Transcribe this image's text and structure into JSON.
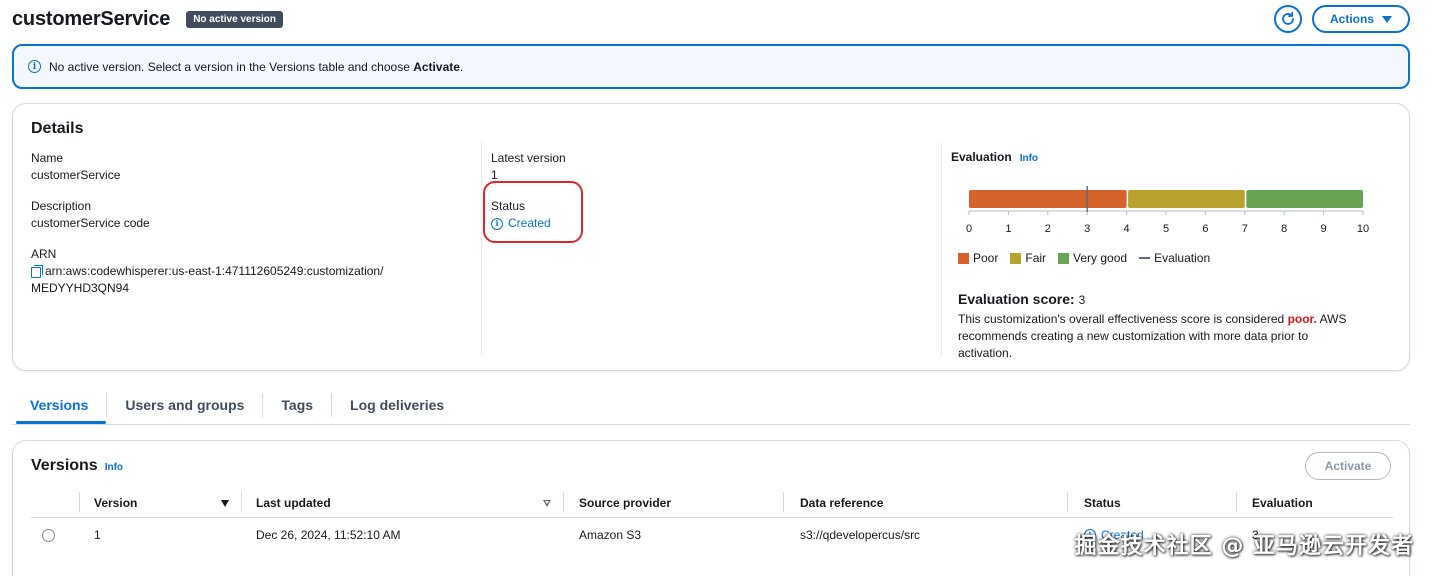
{
  "header": {
    "title": "customerService",
    "badge": "No active version",
    "actions_label": "Actions"
  },
  "alert": {
    "text_prefix": "No active version. Select a version in the Versions table and choose ",
    "text_bold": "Activate",
    "text_suffix": "."
  },
  "details": {
    "title": "Details",
    "name_label": "Name",
    "name_value": "customerService",
    "description_label": "Description",
    "description_value": "customerService code",
    "arn_label": "ARN",
    "arn_line1": "arn:aws:codewhisperer:us-east-1:471112605249:customization/",
    "arn_line2": "MEDYYHD3QN94",
    "latest_version_label": "Latest version",
    "latest_version_value": "1",
    "status_label": "Status",
    "status_value": "Created"
  },
  "evaluation": {
    "title": "Evaluation",
    "info": "Info",
    "scale_ticks": [
      "0",
      "1",
      "2",
      "3",
      "4",
      "5",
      "6",
      "7",
      "8",
      "9",
      "10"
    ],
    "segments": [
      {
        "name": "Poor",
        "from": 0,
        "to": 4,
        "color": "#d4622a"
      },
      {
        "name": "Fair",
        "from": 4,
        "to": 7,
        "color": "#b8a12c"
      },
      {
        "name": "Very good",
        "from": 7,
        "to": 10,
        "color": "#67a353"
      }
    ],
    "score": 3,
    "legend": {
      "poor": "Poor",
      "fair": "Fair",
      "very_good": "Very good",
      "evaluation": "Evaluation"
    },
    "score_label": "Evaluation score:",
    "score_value": "3",
    "desc_prefix": "This customization's overall effectiveness score is considered ",
    "desc_poor": "poor.",
    "desc_suffix": " AWS recommends creating a new customization with more data prior to activation."
  },
  "tabs": [
    {
      "label": "Versions",
      "active": true
    },
    {
      "label": "Users and groups",
      "active": false
    },
    {
      "label": "Tags",
      "active": false
    },
    {
      "label": "Log deliveries",
      "active": false
    }
  ],
  "versions": {
    "title": "Versions",
    "info": "Info",
    "activate_label": "Activate",
    "columns": {
      "version": "Version",
      "last_updated": "Last updated",
      "source_provider": "Source provider",
      "data_reference": "Data reference",
      "status": "Status",
      "evaluation": "Evaluation"
    },
    "rows": [
      {
        "version": "1",
        "last_updated": "Dec 26, 2024, 11:52:10 AM",
        "source_provider": "Amazon S3",
        "data_reference": "s3://qdevelopercus/src",
        "status": "Created",
        "evaluation": "3"
      }
    ]
  },
  "watermark": "掘金技术社区 @ 亚马逊云开发者",
  "colors": {
    "accent": "#0972d3",
    "highlight": "#e0242b",
    "poor": "#d4622a",
    "fair": "#b8a12c",
    "very_good": "#67a353"
  }
}
